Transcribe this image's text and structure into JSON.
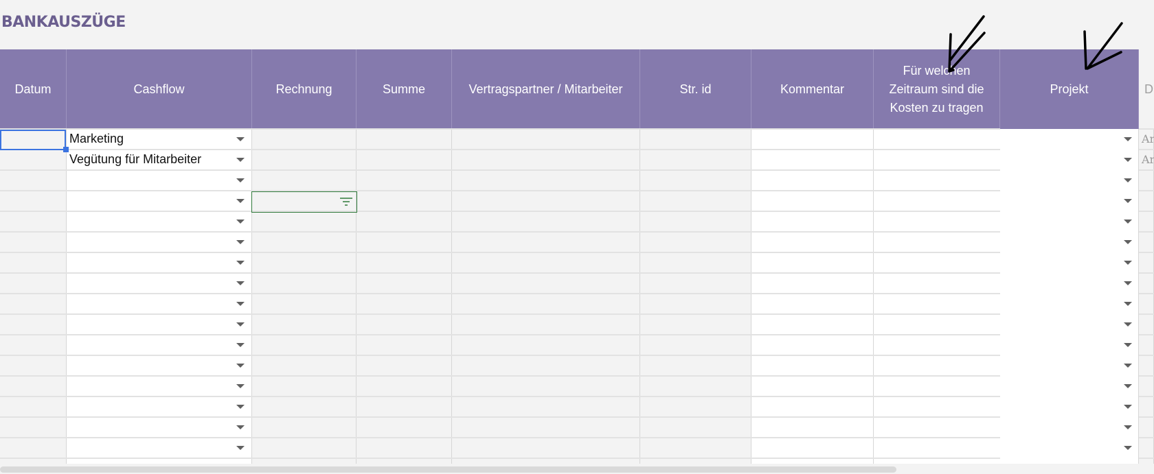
{
  "sheet": {
    "title": "BANKAUSZÜGE",
    "columns": [
      {
        "key": "datum",
        "label": "Datum"
      },
      {
        "key": "cashflow",
        "label": "Cashflow"
      },
      {
        "key": "rechnung",
        "label": "Rechnung"
      },
      {
        "key": "summe",
        "label": "Summe"
      },
      {
        "key": "vertragspartner",
        "label": "Vertragspartner / Mitarbeiter"
      },
      {
        "key": "str_id",
        "label": "Str. id"
      },
      {
        "key": "kommentar",
        "label": "Kommentar"
      },
      {
        "key": "zeitraum",
        "label": "Für welchen Zeitraum sind die Kosten zu tragen"
      },
      {
        "key": "projekt",
        "label": "Projekt"
      },
      {
        "key": "next",
        "label": "D"
      }
    ],
    "rows": [
      {
        "cashflow": "Marketing",
        "next": "Ar"
      },
      {
        "cashflow": "Vegütung für Mitarbeiter",
        "next": "Ar"
      }
    ],
    "dropdown_icon": "chevron-down-icon",
    "filter_icon": "filter-icon",
    "colors": {
      "header_bg": "#857aad",
      "title": "#6b5f8f",
      "selection_blue": "#3b73e0",
      "selection_green": "#2f7a3a",
      "annotation_ink": "#000000"
    }
  }
}
